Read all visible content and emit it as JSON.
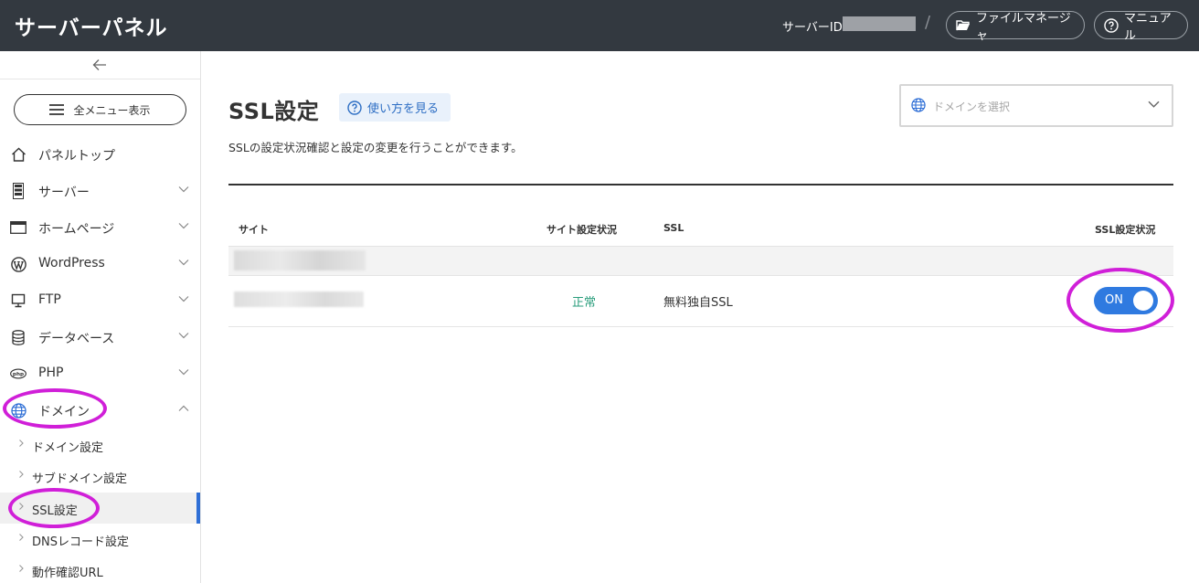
{
  "header": {
    "brand": "サーバーパネル",
    "server_id_label": "サーバーID",
    "separator": "/",
    "file_manager": "ファイルマネージャ",
    "manual": "マニュアル"
  },
  "sidebar": {
    "all_menu": "全メニュー表示",
    "items": [
      {
        "label": "パネルトップ",
        "icon": "home-icon"
      },
      {
        "label": "サーバー",
        "icon": "server-icon"
      },
      {
        "label": "ホームページ",
        "icon": "browser-icon"
      },
      {
        "label": "WordPress",
        "icon": "wordpress-icon"
      },
      {
        "label": "FTP",
        "icon": "monitor-icon"
      },
      {
        "label": "データベース",
        "icon": "database-icon"
      },
      {
        "label": "PHP",
        "icon": "php-icon"
      },
      {
        "label": "ドメイン",
        "icon": "globe-icon"
      }
    ],
    "sub_items": [
      {
        "label": "ドメイン設定"
      },
      {
        "label": "サブドメイン設定"
      },
      {
        "label": "SSL設定",
        "active": true
      },
      {
        "label": "DNSレコード設定"
      },
      {
        "label": "動作確認URL"
      }
    ]
  },
  "main": {
    "title": "SSL設定",
    "help": "使い方を見る",
    "domain_placeholder": "ドメインを選択",
    "description": "SSLの設定状況確認と設定の変更を行うことができます。",
    "table": {
      "headers": [
        "サイト",
        "サイト設定状況",
        "SSL",
        "SSL設定状況"
      ],
      "row": {
        "status": "正常",
        "ssl": "無料独自SSL",
        "toggle": "ON"
      }
    }
  },
  "colors": {
    "header_bg": "#333940",
    "accent": "#2f7ae0",
    "status_ok": "#2a9d7c",
    "annotation": "#d01fd8"
  }
}
